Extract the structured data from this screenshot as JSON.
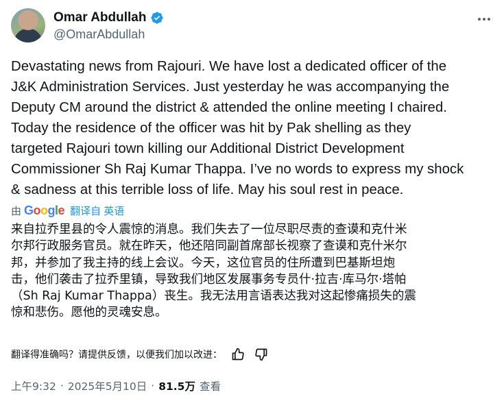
{
  "author": {
    "name": "Omar Abdullah",
    "handle": "@OmarAbdullah",
    "verified_color": "#1d9bf0"
  },
  "tweet": {
    "text": "Devastating news from Rajouri. We have lost a dedicated officer of the\nJ&K Administration Services. Just yesterday he was accompanying the\nDeputy CM around the district & attended the online meeting I chaired.\nToday the residence of the officer was hit by Pak shelling as they\ntargeted Rajouri town killing our Additional District Development\nCommissioner Sh Raj Kumar Thappa. I’ve no words to express my shock\n& sadness at this terrible loss of life. May his soul rest in peace."
  },
  "translation": {
    "by_label": "由",
    "provider_letters": [
      "G",
      "o",
      "o",
      "g",
      "l",
      "e"
    ],
    "link_label": "翻译自 英语",
    "text": "来自拉乔里县的令人震惊的消息。我们失去了一位尽职尽责的查谟和克什米\n尔邦行政服务官员。就在昨天，他还陪同副首席部长视察了查谟和克什米尔\n邦，并参加了我主持的线上会议。今天，这位官员的住所遭到巴基斯坦炮\n击，他们袭击了拉乔里镇，导致我们地区发展事务专员什·拉吉·库马尔·塔帕\n（Sh Raj Kumar Thappa）丧生。我无法用言语表达我对这起惨痛损失的震\n惊和悲伤。愿他的灵魂安息。",
    "feedback_prompt": "翻译得准确吗？请提供反馈，以便我们加以改进："
  },
  "meta": {
    "time": "上午9:32",
    "sep1": "·",
    "date": "2025年5月10日",
    "sep2": "·",
    "views": "81.5万",
    "views_label": "查看"
  },
  "icons": {
    "more": "more-icon",
    "verified": "verified-badge-icon",
    "thumbs_up": "thumbs-up-icon",
    "thumbs_down": "thumbs-down-icon"
  }
}
